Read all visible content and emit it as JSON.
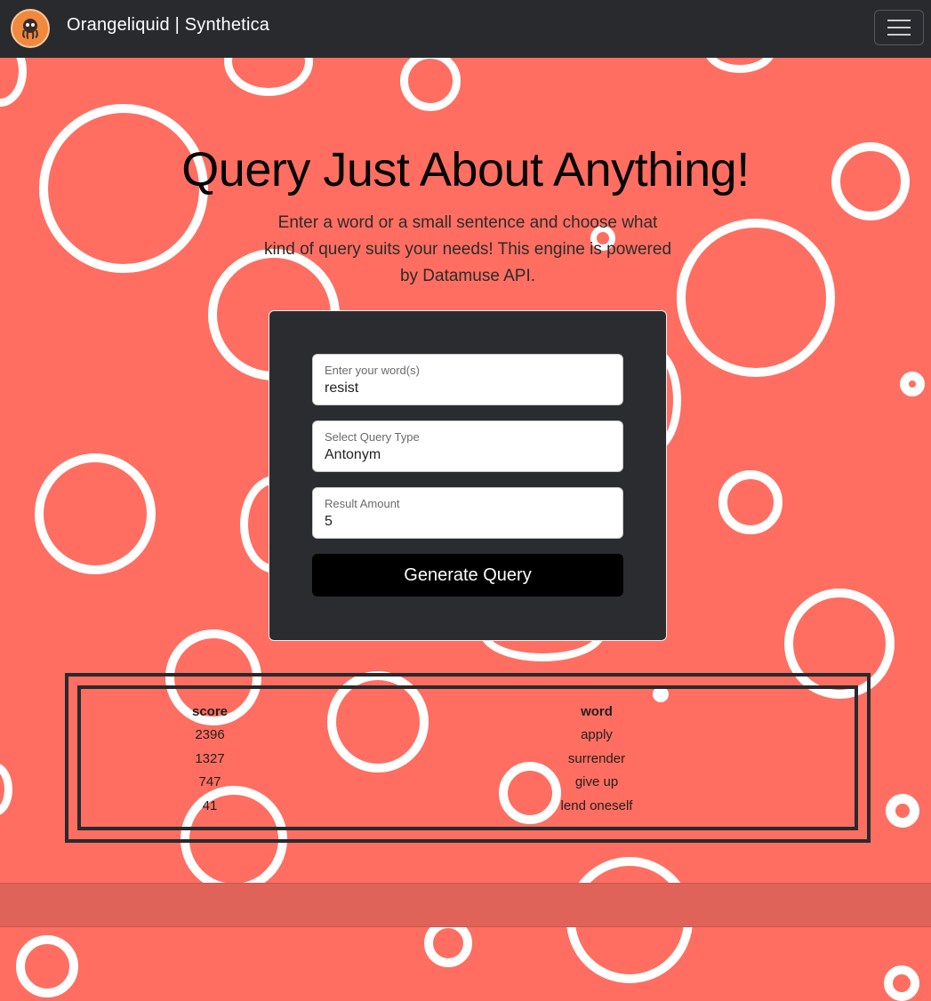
{
  "navbar": {
    "brand": "Orangeliquid | Synthetica",
    "logo_icon": "octopus-logo-icon",
    "menu_icon": "hamburger-menu-icon"
  },
  "hero": {
    "title": "Query Just About Anything!",
    "description": "Enter a word or a small sentence and choose what kind of query suits your needs! This engine is powered by Datamuse API."
  },
  "form": {
    "word_label": "Enter your word(s)",
    "word_value": "resist",
    "query_type_label": "Select Query Type",
    "query_type_value": "Antonym",
    "amount_label": "Result Amount",
    "amount_value": "5",
    "submit_label": "Generate Query"
  },
  "results": {
    "headers": [
      "score",
      "word"
    ],
    "rows": [
      [
        "2396",
        "apply"
      ],
      [
        "1327",
        "surrender"
      ],
      [
        "747",
        "give up"
      ],
      [
        "41",
        "lend oneself"
      ]
    ]
  },
  "colors": {
    "background": "#ff6e61",
    "navbar": "#282a2e",
    "card": "#2a2c30",
    "button": "#000000",
    "circle": "#ffffff"
  }
}
